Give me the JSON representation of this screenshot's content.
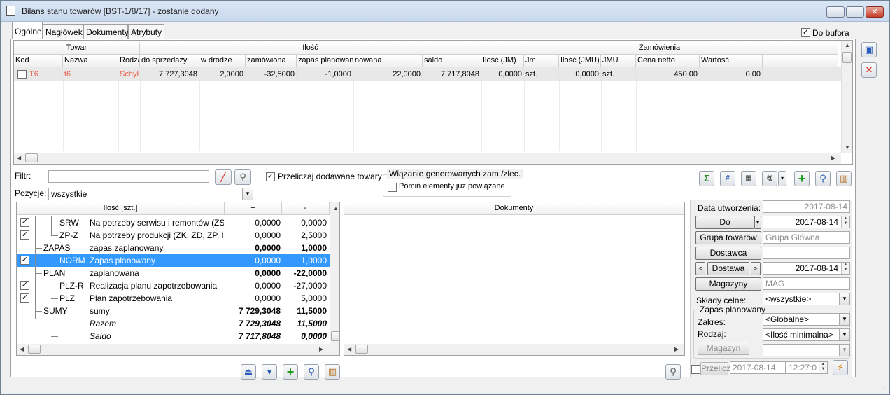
{
  "window": {
    "title": "Bilans stanu towarów [BST-1/8/17] - zostanie dodany"
  },
  "tabs": [
    "Ogólne",
    "Nagłówek",
    "Dokumenty",
    "Atrybuty"
  ],
  "do_bufora": {
    "label": "Do bufora",
    "checked": true
  },
  "grid": {
    "groups": {
      "towar": "Towar",
      "ilosc": "Ilość",
      "zamowienia": "Zamówienia"
    },
    "columns": [
      "Kod",
      "Nazwa",
      "Rodza",
      "do sprzedaży",
      "w drodze",
      "zamówiona",
      "zapas planowan",
      "nowana",
      "saldo",
      "Ilość (JM)",
      "Jm.",
      "Ilość (JMU)",
      "JMU",
      "Cena netto",
      "Wartość"
    ],
    "row": [
      "T6",
      "t6",
      "Schył",
      "7 727,3048",
      "2,0000",
      "-32,5000",
      "-1,0000",
      "22,0000",
      "7 717,8048",
      "0,0000",
      "szt.",
      "0,0000",
      "szt.",
      "450,00",
      "0,00"
    ]
  },
  "filter": {
    "label": "Filtr:",
    "value": ""
  },
  "przeliczaj": {
    "label": "Przeliczaj dodawane towary",
    "checked": true
  },
  "wiazanie": {
    "title": "Wiązanie generowanych zam./zlec.",
    "pomin": "Pomiń elementy już powiązane"
  },
  "pozycje": {
    "label": "Pozycje:",
    "value": "wszystkie"
  },
  "tree": {
    "headers": [
      "Ilość [szt.]",
      "+",
      "-"
    ],
    "rows": [
      {
        "code": "SRW",
        "name": "Na potrzeby serwisu i remontów (ZSE, Z",
        "plus": "0,0000",
        "minus": "0,0000",
        "checked": true,
        "level": 2,
        "bold": false
      },
      {
        "code": "ZP-Z",
        "name": "Na potrzeby produkcji (ZK, ZD, ZP, HPR)",
        "plus": "0,0000",
        "minus": "2,5000",
        "checked": true,
        "level": 2,
        "bold": false
      },
      {
        "code": "ZAPAS",
        "name": "zapas zaplanowany",
        "plus": "0,0000",
        "minus": "1,0000",
        "checked": false,
        "level": 1,
        "bold": true
      },
      {
        "code": "NORM",
        "name": "Zapas planowany",
        "plus": "0,0000",
        "minus": "1,0000",
        "checked": true,
        "level": 2,
        "bold": false,
        "selected": true
      },
      {
        "code": "PLAN",
        "name": "zaplanowana",
        "plus": "0,0000",
        "minus": "-22,0000",
        "checked": false,
        "level": 1,
        "bold": true
      },
      {
        "code": "PLZ-R",
        "name": "Realizacja planu zapotrzebowania",
        "plus": "0,0000",
        "minus": "-27,0000",
        "checked": true,
        "level": 2,
        "bold": false
      },
      {
        "code": "PLZ",
        "name": "Plan zapotrzebowania",
        "plus": "0,0000",
        "minus": "5,0000",
        "checked": true,
        "level": 2,
        "bold": false
      },
      {
        "code": "SUMY",
        "name": "sumy",
        "plus": "7 729,3048",
        "minus": "11,5000",
        "checked": false,
        "level": 1,
        "bold": true
      },
      {
        "code": "",
        "name": "Razem",
        "plus": "7 729,3048",
        "minus": "11,5000",
        "checked": false,
        "level": 2,
        "bold": true,
        "italic": true
      },
      {
        "code": "",
        "name": "Saldo",
        "plus": "7 717,8048",
        "minus": "0,0000",
        "checked": false,
        "level": 2,
        "bold": true,
        "italic": true
      }
    ]
  },
  "docs": {
    "header": "Dokumenty"
  },
  "side": {
    "data_utworzenia_label": "Data utworzenia:",
    "data_utworzenia": "2017-08-14",
    "do_btn": "Do",
    "do_date": "2017-08-14",
    "grupa_btn": "Grupa towarów",
    "grupa_value": "Grupa Główna",
    "dostawca_btn": "Dostawca",
    "dostawa_btn": "Dostawa",
    "dostawa_date": "2017-08-14",
    "magazyny_btn": "Magazyny",
    "magazyny_value": "MAG",
    "sklady_label": "Składy celne:",
    "sklady_value": "<wszystkie>",
    "zapas_title": "Zapas planowany",
    "zakres_label": "Zakres:",
    "zakres_value": "<Globalne>",
    "rodzaj_label": "Rodzaj:",
    "rodzaj_value": "<Ilość minimalna>",
    "magazyn_btn": "Magazyn",
    "przelicz_label": "Przelicz",
    "przelicz_date": "2017-08-14",
    "przelicz_time": "12:27:0"
  },
  "colors": {
    "accent": "#3399ff",
    "red_text": "#e8604c",
    "title_bar": "#c9d9ee"
  }
}
